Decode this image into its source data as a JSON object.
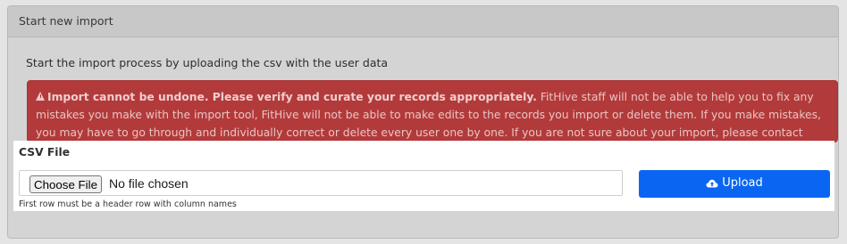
{
  "card": {
    "title": "Start new import"
  },
  "intro": {
    "text": "Start the import process by uploading the csv with the user data"
  },
  "alert": {
    "icon": "warning-icon",
    "heading": "Import cannot be undone. Please verify and curate your records appropriately.",
    "body": "FitHive staff will not be able to help you to fix any mistakes you make with the import tool, FitHive will not be able to make edits to the records you import or delete them. If you make mistakes, you may have to go through and individually correct or delete every user one by one. If you are not sure about your import, please contact FitHive support.",
    "color": "#b33a3a"
  },
  "csv": {
    "label": "CSV File",
    "choose_button": "Choose File",
    "file_status": "No file chosen",
    "help": "First row must be a header row with column names"
  },
  "upload": {
    "label": "Upload",
    "icon": "cloud-upload-icon",
    "color": "#0a66f2"
  }
}
